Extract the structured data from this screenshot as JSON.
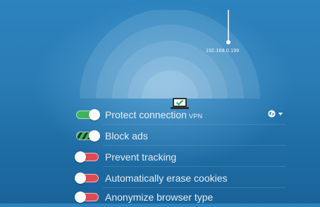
{
  "connection": {
    "ip_address": "192.168.0.199"
  },
  "settings": {
    "items": [
      {
        "label": "Protect connection",
        "tag": "VPN",
        "state": "on"
      },
      {
        "label": "Block ads",
        "tag": "",
        "state": "on"
      },
      {
        "label": "Prevent tracking",
        "tag": "",
        "state": "off"
      },
      {
        "label": "Automatically erase cookies",
        "tag": "",
        "state": "off"
      },
      {
        "label": "Anonymize browser type",
        "tag": "",
        "state": "off"
      }
    ]
  },
  "icons": {
    "laptop": "laptop-check-icon",
    "globe": "globe-icon",
    "dropdown": "chevron-down-icon"
  },
  "colors": {
    "background": "#2a7cb5",
    "toggle_on": "#3db45a",
    "toggle_off": "#e04a55",
    "check": "#2db36a"
  }
}
